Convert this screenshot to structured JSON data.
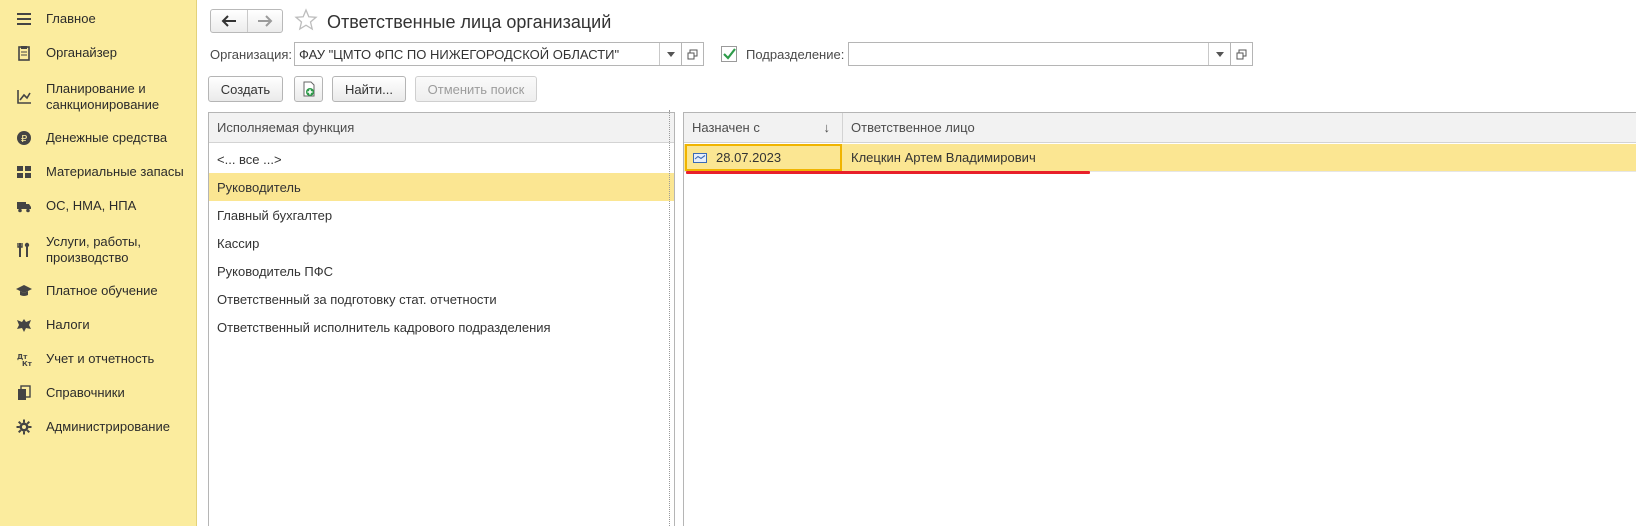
{
  "sidebar": {
    "items": [
      {
        "label": "Главное",
        "icon": "menu-lines-icon"
      },
      {
        "label": "Органайзер",
        "icon": "clipboard-icon"
      },
      {
        "label": "Планирование и санкционирование",
        "icon": "planning-chart-icon"
      },
      {
        "label": "Денежные средства",
        "icon": "ruble-coin-icon"
      },
      {
        "label": "Материальные запасы",
        "icon": "grid-stock-icon"
      },
      {
        "label": "ОС, НМА, НПА",
        "icon": "truck-icon"
      },
      {
        "label": "Услуги, работы, производство",
        "icon": "tools-icon"
      },
      {
        "label": "Платное обучение",
        "icon": "graduation-cap-icon"
      },
      {
        "label": "Налоги",
        "icon": "eagle-emblem-icon"
      },
      {
        "label": "Учет и отчетность",
        "icon": "debit-credit-icon"
      },
      {
        "label": "Справочники",
        "icon": "books-icon"
      },
      {
        "label": "Администрирование",
        "icon": "gear-icon"
      }
    ]
  },
  "header": {
    "title": "Ответственные лица организаций"
  },
  "filters": {
    "org_label": "Организация:",
    "org_value": "ФАУ \"ЦМТО ФПС ПО НИЖЕГОРОДСКОЙ ОБЛАСТИ\"",
    "dept_checked": true,
    "dept_label": "Подразделение:",
    "dept_value": ""
  },
  "toolbar": {
    "create_label": "Создать",
    "find_label": "Найти...",
    "cancel_search_label": "Отменить поиск"
  },
  "functions": {
    "header": "Исполняемая функция",
    "rows": [
      "<... все ...>",
      "Руководитель",
      "Главный бухгалтер",
      "Кассир",
      "Руководитель ПФС",
      "Ответственный за подготовку стат. отчетности",
      "Ответственный исполнитель кадрового подразделения"
    ],
    "selected_index": 1
  },
  "assignments": {
    "col_date": "Назначен с",
    "sort_indicator": "↓",
    "col_person": "Ответственное лицо",
    "rows": [
      {
        "date": "28.07.2023",
        "person": "Клецкин Артем Владимирович"
      }
    ]
  },
  "colors": {
    "sidebar_bg": "#fbec9e",
    "selection": "#fbe692",
    "current_cell_border": "#f0b400",
    "annotation_underline": "#e8202a",
    "checkbox_mark": "#2e9b4a"
  }
}
